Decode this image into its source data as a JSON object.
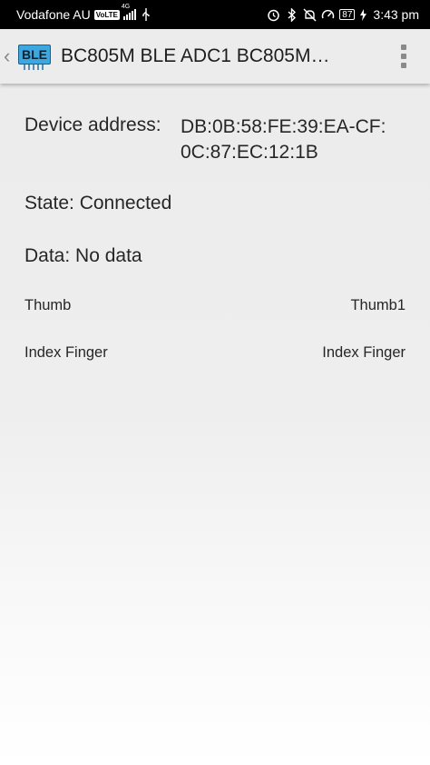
{
  "status_bar": {
    "carrier": "Vodafone AU",
    "volte": "VoLTE",
    "network": "4G",
    "battery": "87",
    "time": "3:43 pm",
    "icons": [
      "alarm-icon",
      "bluetooth-icon",
      "mute-icon",
      "speedometer-icon",
      "usb-icon",
      "charging-icon"
    ]
  },
  "app_bar": {
    "back_glyph": "‹",
    "logo_text": "BLE",
    "title": "BC805M BLE ADC1 BC805M…"
  },
  "details": {
    "address_label": "Device address:",
    "address_line1": "DB:0B:58:FE:39:EA-CF:",
    "address_line2": "0C:87:EC:12:1B",
    "state": "State: Connected",
    "data": "Data: No data"
  },
  "fingers": [
    {
      "label": "Thumb",
      "value": "Thumb1"
    },
    {
      "label": "Index Finger",
      "value": "Index Finger"
    }
  ]
}
